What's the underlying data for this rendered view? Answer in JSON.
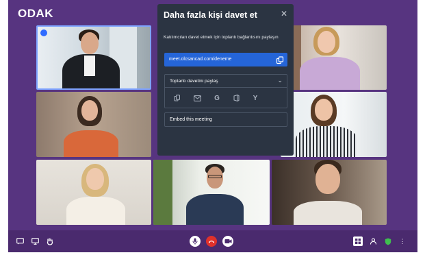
{
  "app": {
    "logo": "ODAK"
  },
  "dialog": {
    "title": "Daha fazla kişi davet et",
    "close_glyph": "✕",
    "description": "Katılımcıları davet etmek için toplantı bağlantısını paylaşın",
    "meeting_link": "meet.olcsancad.com/deneme",
    "share_label": "Toplantı davetini paylaş",
    "share_chevron": "⌄",
    "share_icons": [
      "copy-icon",
      "email-icon",
      "google-icon",
      "office-icon",
      "yahoo-icon"
    ],
    "share_icon_glyphs": [
      "",
      "",
      "G",
      "",
      "Y"
    ],
    "embed_label": "Embed this meeting"
  },
  "toolbar": {
    "left_icons": [
      "chat-icon",
      "screen-share-icon",
      "raise-hand-icon"
    ],
    "center_icons": [
      "microphone-icon",
      "hangup-icon",
      "camera-icon"
    ],
    "right_icons": [
      "tile-view-icon",
      "participants-icon",
      "security-icon",
      "more-icon"
    ],
    "more_glyph": "⋮"
  },
  "colors": {
    "background": "#573480",
    "toolbar": "#4a2a6e",
    "dialog": "#2b3442",
    "link_box": "#2565d8",
    "hangup": "#e0312b",
    "security": "#3fbf4f",
    "active_speaker_border": "#7ea3ff"
  }
}
